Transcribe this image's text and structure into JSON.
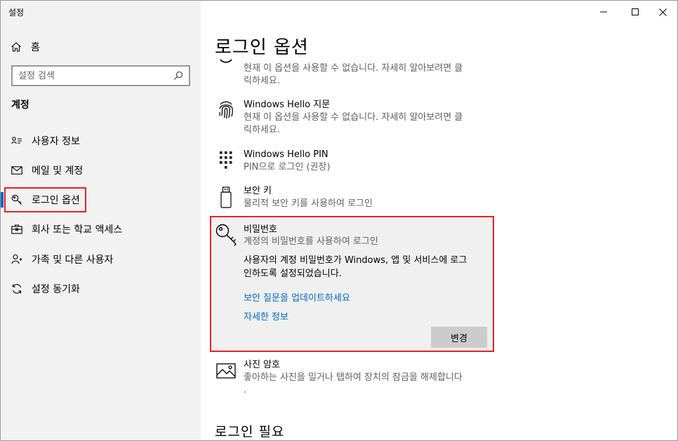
{
  "window": {
    "title": "설정"
  },
  "sidebar": {
    "home_label": "홈",
    "search_placeholder": "설정 검색",
    "section_label": "계정",
    "items": [
      {
        "label": "사용자 정보",
        "icon": "person-card-icon"
      },
      {
        "label": "메일 및 계정",
        "icon": "mail-icon"
      },
      {
        "label": "로그인 옵션",
        "icon": "key-icon",
        "active": true
      },
      {
        "label": "회사 또는 학교 액세스",
        "icon": "briefcase-icon"
      },
      {
        "label": "가족 및 다른 사용자",
        "icon": "person-add-icon"
      },
      {
        "label": "설정 동기화",
        "icon": "sync-icon"
      }
    ]
  },
  "main": {
    "page_title": "로그인 옵션",
    "options": [
      {
        "name": "",
        "desc_line1": "현재 이 옵션을 사용할 수 없습니다. 자세히 알아보려면 클",
        "desc_line2": "릭하세요.",
        "icon": "face-icon"
      },
      {
        "name": "Windows Hello 지문",
        "desc_line1": "현재 이 옵션을 사용할 수 없습니다. 자세히 알아보려면 클",
        "desc_line2": "릭하세요.",
        "icon": "fingerprint-icon"
      },
      {
        "name": "Windows Hello PIN",
        "desc_line1": "PIN으로 로그인 (권장)",
        "icon": "pin-pad-icon"
      },
      {
        "name": "보안 키",
        "desc_line1": "물리적 보안 키를 사용하여 로그인",
        "icon": "usb-key-icon"
      },
      {
        "name": "사진 암호",
        "desc_line1": "좋아하는 사진을 밀거나 탭하여 장치의 잠금을 해제합니다",
        "desc_line2": ".",
        "icon": "picture-icon"
      }
    ],
    "password": {
      "name": "비밀번호",
      "desc": "계정의 비밀번호를 사용하여 로그인",
      "body_line1": "사용자의 계정 비밀번호가 Windows, 앱 및 서비스에 로그",
      "body_line2": "인하도록 설정되었습니다.",
      "link_update": "보안 질문을 업데이트하세요",
      "link_more": "자세한 정보",
      "change_button": "변경"
    },
    "section_require": "로그인 필요"
  },
  "colors": {
    "accent": "#0067c0",
    "highlight": "#e3222a",
    "sidebar_bg": "#f2f2f2",
    "panel_bg": "#f0f0f0"
  }
}
